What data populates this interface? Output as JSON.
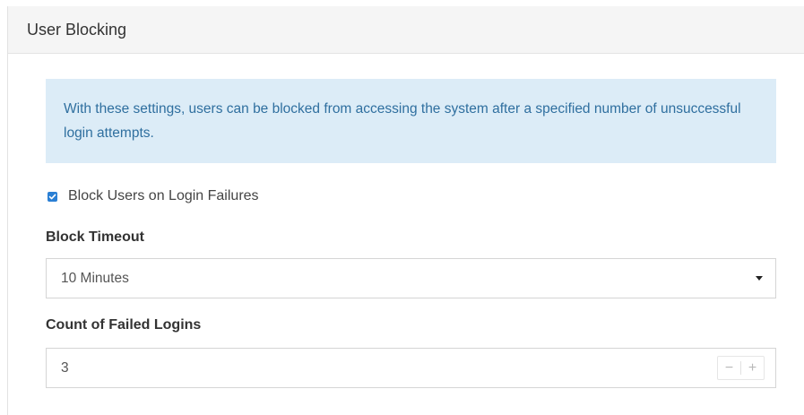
{
  "panel": {
    "title": "User Blocking"
  },
  "info": {
    "text": "With these settings, users can be blocked from accessing the system after a specified number of unsuccessful login attempts."
  },
  "block_users": {
    "label": "Block Users on Login Failures",
    "checked": true
  },
  "block_timeout": {
    "label": "Block Timeout",
    "value": "10 Minutes"
  },
  "failed_logins": {
    "label": "Count of Failed Logins",
    "value": "3",
    "decrement_label": "−",
    "increment_label": "+"
  },
  "colors": {
    "accent": "#2a7fd4",
    "info_background": "#dcecf7",
    "info_text": "#2f6f9f",
    "header_background": "#f5f5f5"
  }
}
